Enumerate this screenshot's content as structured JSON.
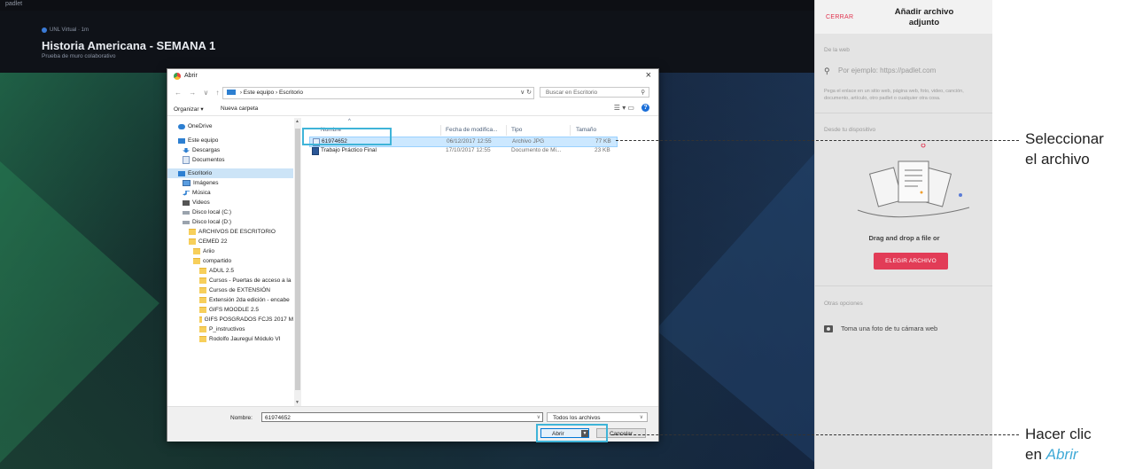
{
  "topbar": {
    "logo": "padlet"
  },
  "board": {
    "meta": "UNL Virtual · 1m",
    "title": "Historia Americana - SEMANA 1",
    "subtitle": "Prueba de muro colaborativo"
  },
  "dialog": {
    "title": "Abrir",
    "close": "×",
    "nav_buttons": "← → ∨ ↑",
    "address": {
      "pc": "Este equipo",
      "sep": "›",
      "folder": "Escritorio",
      "refresh": "∨ ↻"
    },
    "search_placeholder": "Buscar en Escritorio",
    "toolbar": {
      "organize": "Organizar ▾",
      "new_folder": "Nueva carpeta",
      "tools": "☰ ▾  ▭"
    },
    "nav_items": [
      {
        "label": "OneDrive",
        "icon": "cloud-icon"
      },
      {
        "label": "Este equipo",
        "icon": "computer-icon"
      },
      {
        "label": "Descargas",
        "icon": "download-icon"
      },
      {
        "label": "Documentos",
        "icon": "document-icon"
      },
      {
        "label": "Escritorio",
        "icon": "desktop-icon",
        "selected": true
      },
      {
        "label": "Imágenes",
        "icon": "image-icon"
      },
      {
        "label": "Música",
        "icon": "music-icon"
      },
      {
        "label": "Videos",
        "icon": "video-icon"
      },
      {
        "label": "Disco local (C:)",
        "icon": "disk-icon"
      },
      {
        "label": "Disco local (D:)",
        "icon": "disk-icon"
      },
      {
        "label": "ARCHIVOS DE ESCRITORIO",
        "icon": "folder-icon"
      },
      {
        "label": "CEMED 22",
        "icon": "folder-icon"
      },
      {
        "label": "Ariio",
        "icon": "folder-icon"
      },
      {
        "label": "compartido",
        "icon": "folder-icon"
      },
      {
        "label": "ADUL 2.5",
        "icon": "folder-icon"
      },
      {
        "label": "Cursos - Puertas de acceso a la",
        "icon": "folder-icon"
      },
      {
        "label": "Cursos de EXTENSIÓN",
        "icon": "folder-icon"
      },
      {
        "label": "Extensión 2da edición - encabe",
        "icon": "folder-icon"
      },
      {
        "label": "GIFS MOODLE 2.5",
        "icon": "folder-icon"
      },
      {
        "label": "GIFS POSGRADOS FCJS 2017 M",
        "icon": "folder-icon"
      },
      {
        "label": "P_instructivos",
        "icon": "folder-icon"
      },
      {
        "label": "Rodolfo Jaureguí Módulo VI",
        "icon": "folder-icon"
      }
    ],
    "columns": {
      "name": "Nombre",
      "date": "Fecha de modifica...",
      "type": "Tipo",
      "size": "Tamaño"
    },
    "files": [
      {
        "name": "61974652",
        "date": "06/12/2017 12:55",
        "type": "Archivo JPG",
        "size": "77 KB",
        "selected": true
      },
      {
        "name": "Trabajo Práctico Final",
        "date": "17/10/2017 12:55",
        "type": "Documento de Mi...",
        "size": "23 KB",
        "selected": false
      }
    ],
    "filename_label": "Nombre:",
    "filename_value": "61974652",
    "filetype": "Todos los archivos",
    "open_button": "Abrir",
    "cancel_button": "Cancelar"
  },
  "panel": {
    "close": "CERRAR",
    "title_line1": "Añadir archivo",
    "title_line2": "adjunto",
    "web_section": "De la web",
    "search_placeholder": "Por ejemplo: https://padlet.com",
    "search_desc_line1": "Pega el enlace en un sitio web, página web, foto, video, canción,",
    "search_desc_line2": "documento, artículo, otro padlet o cualquier otra cosa.",
    "device_section": "Desde tu dispositivo",
    "drag_text": "Drag and drop a file or",
    "choose_button": "ELEGIR ARCHIVO",
    "other_section": "Otras opciones",
    "camera_option": "Toma una foto de tu cámara web"
  },
  "annotations": {
    "select_line1": "Seleccionar",
    "select_line2": "el archivo",
    "click_line1": "Hacer clic",
    "click_prefix": "en ",
    "click_em": "Abrir"
  },
  "colors": {
    "accent_pink": "#e23c57",
    "highlight_blue": "#3fb4d8",
    "windows_blue": "#0078d7"
  }
}
